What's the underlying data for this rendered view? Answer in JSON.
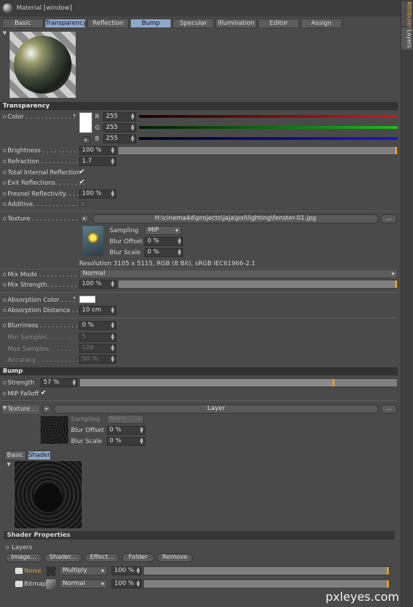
{
  "window": {
    "title": "Material [window]"
  },
  "tabs": [
    "Basic",
    "Transparency",
    "Reflection",
    "Bump",
    "Specular",
    "Illumination",
    "Editor",
    "Assign"
  ],
  "side_tabs": [
    "Attributes",
    "Layers"
  ],
  "transparency": {
    "section": "Transparency",
    "color_label": "Color . . . . . . . . . . . . .",
    "r_label": "R",
    "g_label": "G",
    "b_label": "B",
    "r": "255",
    "g": "255",
    "b": "255",
    "brightness_label": "Brightness  . . . . . . . . . .",
    "brightness": "100 %",
    "refraction_label": "Refraction . . . . . . . . . . .",
    "refraction": "1.7",
    "tir_label": "Total Internal Reflection",
    "exit_label": "Exit Reflections. . . . . . . .",
    "fresnel_label": "Fresnel Reflectivity. . . . .",
    "fresnel": "100 %",
    "additive_label": "Additive. . . . . . . . . . . . . .",
    "texture_label": "Texture  . . . . . . . . . . . . .",
    "texture_path": "H:\\cinema4d\\projects\\jaja\\pxl\\lighting\\fenster-01.jpg",
    "more": "...",
    "sampling_label": "Sampling",
    "sampling": "MIP",
    "blur_offset_label": "Blur Offset",
    "blur_offset": "0 %",
    "blur_scale_label": "Blur Scale",
    "blur_scale": "0 %",
    "resolution": "Resolution 3105 x 5115, RGB (8 Bit), sRGB IEC61966-2.1",
    "mix_mode_label": "Mix Mode  . . . . . . . . . . .",
    "mix_mode": "Normal",
    "mix_strength_label": "Mix Strength. . . . . . . . . .",
    "mix_strength": "100 %",
    "absorption_color_label": "Absorption Color . . . .",
    "absorption_distance_label": "Absorption Distance . . .",
    "absorption_distance": "10 cm",
    "blurriness_label": "Blurriness . . . . . . . . . . .",
    "blurriness": "0 %",
    "min_samples_label": "Min Samples. . . . . . . . . .",
    "min_samples": "5",
    "max_samples_label": "Max Samples. . . . . . . . .",
    "max_samples": "128",
    "accuracy_label": "Accuracy  . . . . . . . . . . .",
    "accuracy": "50 %"
  },
  "bump": {
    "section": "Bump",
    "strength_label": "Strength",
    "strength": "57 %",
    "strength_fraction": 0.8,
    "mip_label": "MIP Falloff",
    "texture_label": "Texture  . .",
    "texture_name": "Layer",
    "more": "...",
    "sampling_label": "Sampling",
    "sampling": "None",
    "blur_offset_label": "Blur Offset",
    "blur_offset": "0 %",
    "blur_scale_label": "Blur Scale",
    "blur_scale": "0 %",
    "subtabs": [
      "Basic",
      "Shader"
    ],
    "shader_props": "Shader Properties",
    "layers_label": "Layers",
    "buttons": [
      "Image...",
      "Shader...",
      "Effect...",
      "Folder",
      "Remove"
    ],
    "layer_rows": [
      {
        "name": "Noise",
        "mode": "Multiply",
        "value": "100 %"
      },
      {
        "name": "Bitmap",
        "mode": "Normal",
        "value": "100 %"
      }
    ]
  },
  "watermark": "pxleyes.com",
  "colors": {
    "accent": "#e8a020",
    "selected_tab": "#8ea7c8",
    "red": "#d01818",
    "green": "#18c018",
    "blue": "#1818d0"
  }
}
